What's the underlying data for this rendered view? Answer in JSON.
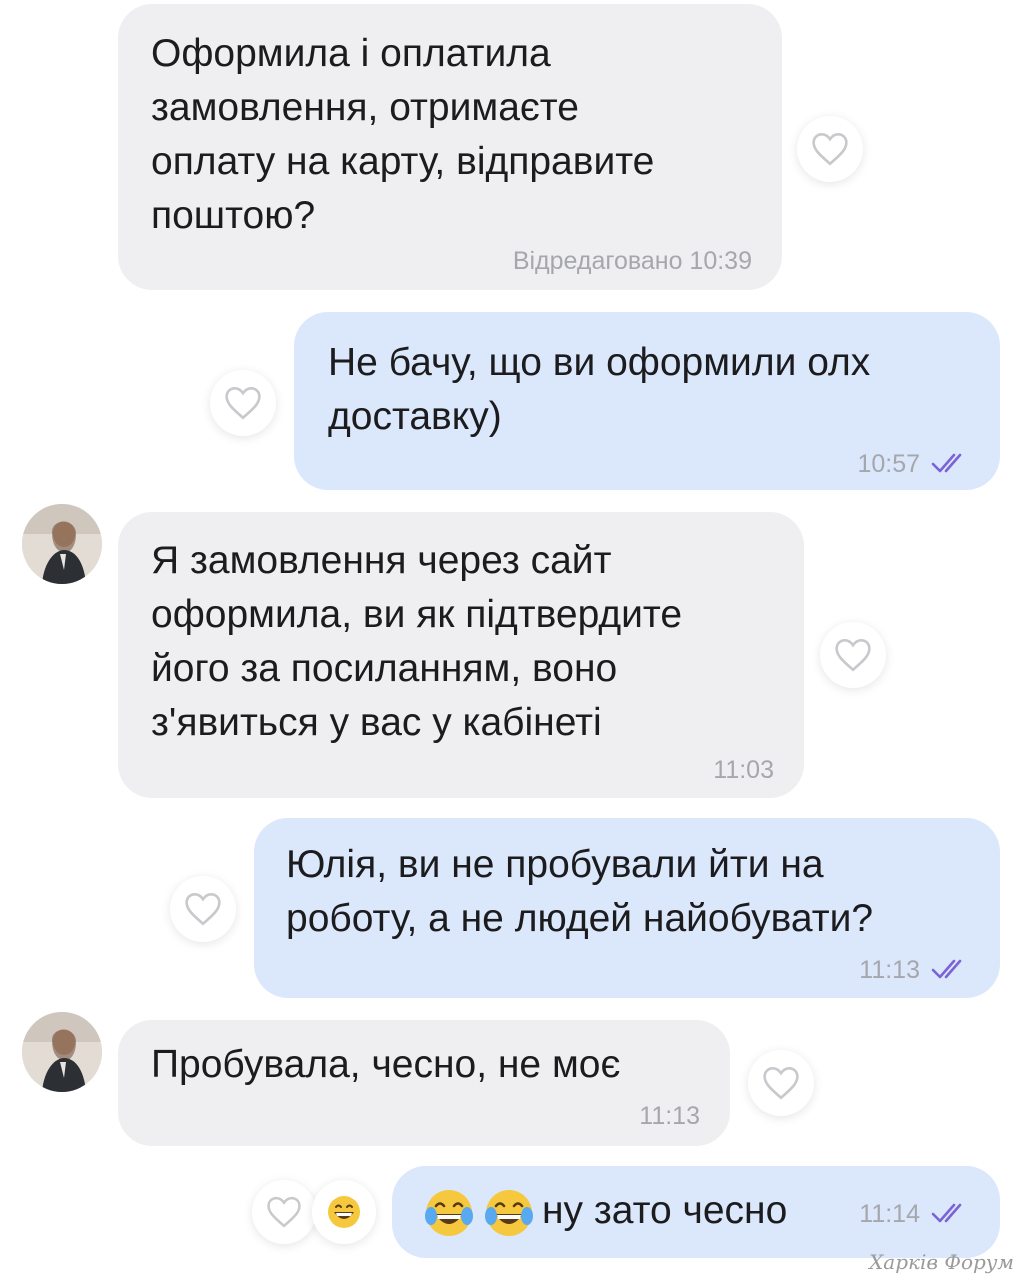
{
  "messages": [
    {
      "direction": "incoming",
      "text": "Оформила і оплатила\nзамовлення, отримаєте\nоплату на карту, відправите\nпоштою?",
      "time": "Відредаговано 10:39"
    },
    {
      "direction": "outgoing",
      "text": "Не бачу, що ви оформили олх\nдоставку)",
      "time": "10:57",
      "status": "read"
    },
    {
      "direction": "incoming",
      "text": "Я замовлення через сайт\nоформила, ви як підтвердите\nйого за посиланням, воно\nз'явиться у вас у кабінеті",
      "time": "11:03",
      "avatar": true
    },
    {
      "direction": "outgoing",
      "text": "Юлія, ви не пробували йти на\nроботу, а не людей найобувати?",
      "time": "11:13",
      "status": "read"
    },
    {
      "direction": "incoming",
      "text": "Пробувала, чесно, не моє",
      "time": "11:13",
      "avatar": true
    },
    {
      "direction": "outgoing",
      "text": "ну зато чесно",
      "time": "11:14",
      "status": "read",
      "emoji_prefix": [
        "😂",
        "😂"
      ],
      "reaction": "😄"
    }
  ],
  "icons": {
    "like": "heart-outline-icon",
    "read": "double-check-icon"
  },
  "colors": {
    "incoming_bubble": "#efeff1",
    "outgoing_bubble": "#dbe7fb",
    "time_text": "#a6a7ad",
    "read_check": "#7b62d6"
  },
  "watermark": "Харків Форум"
}
